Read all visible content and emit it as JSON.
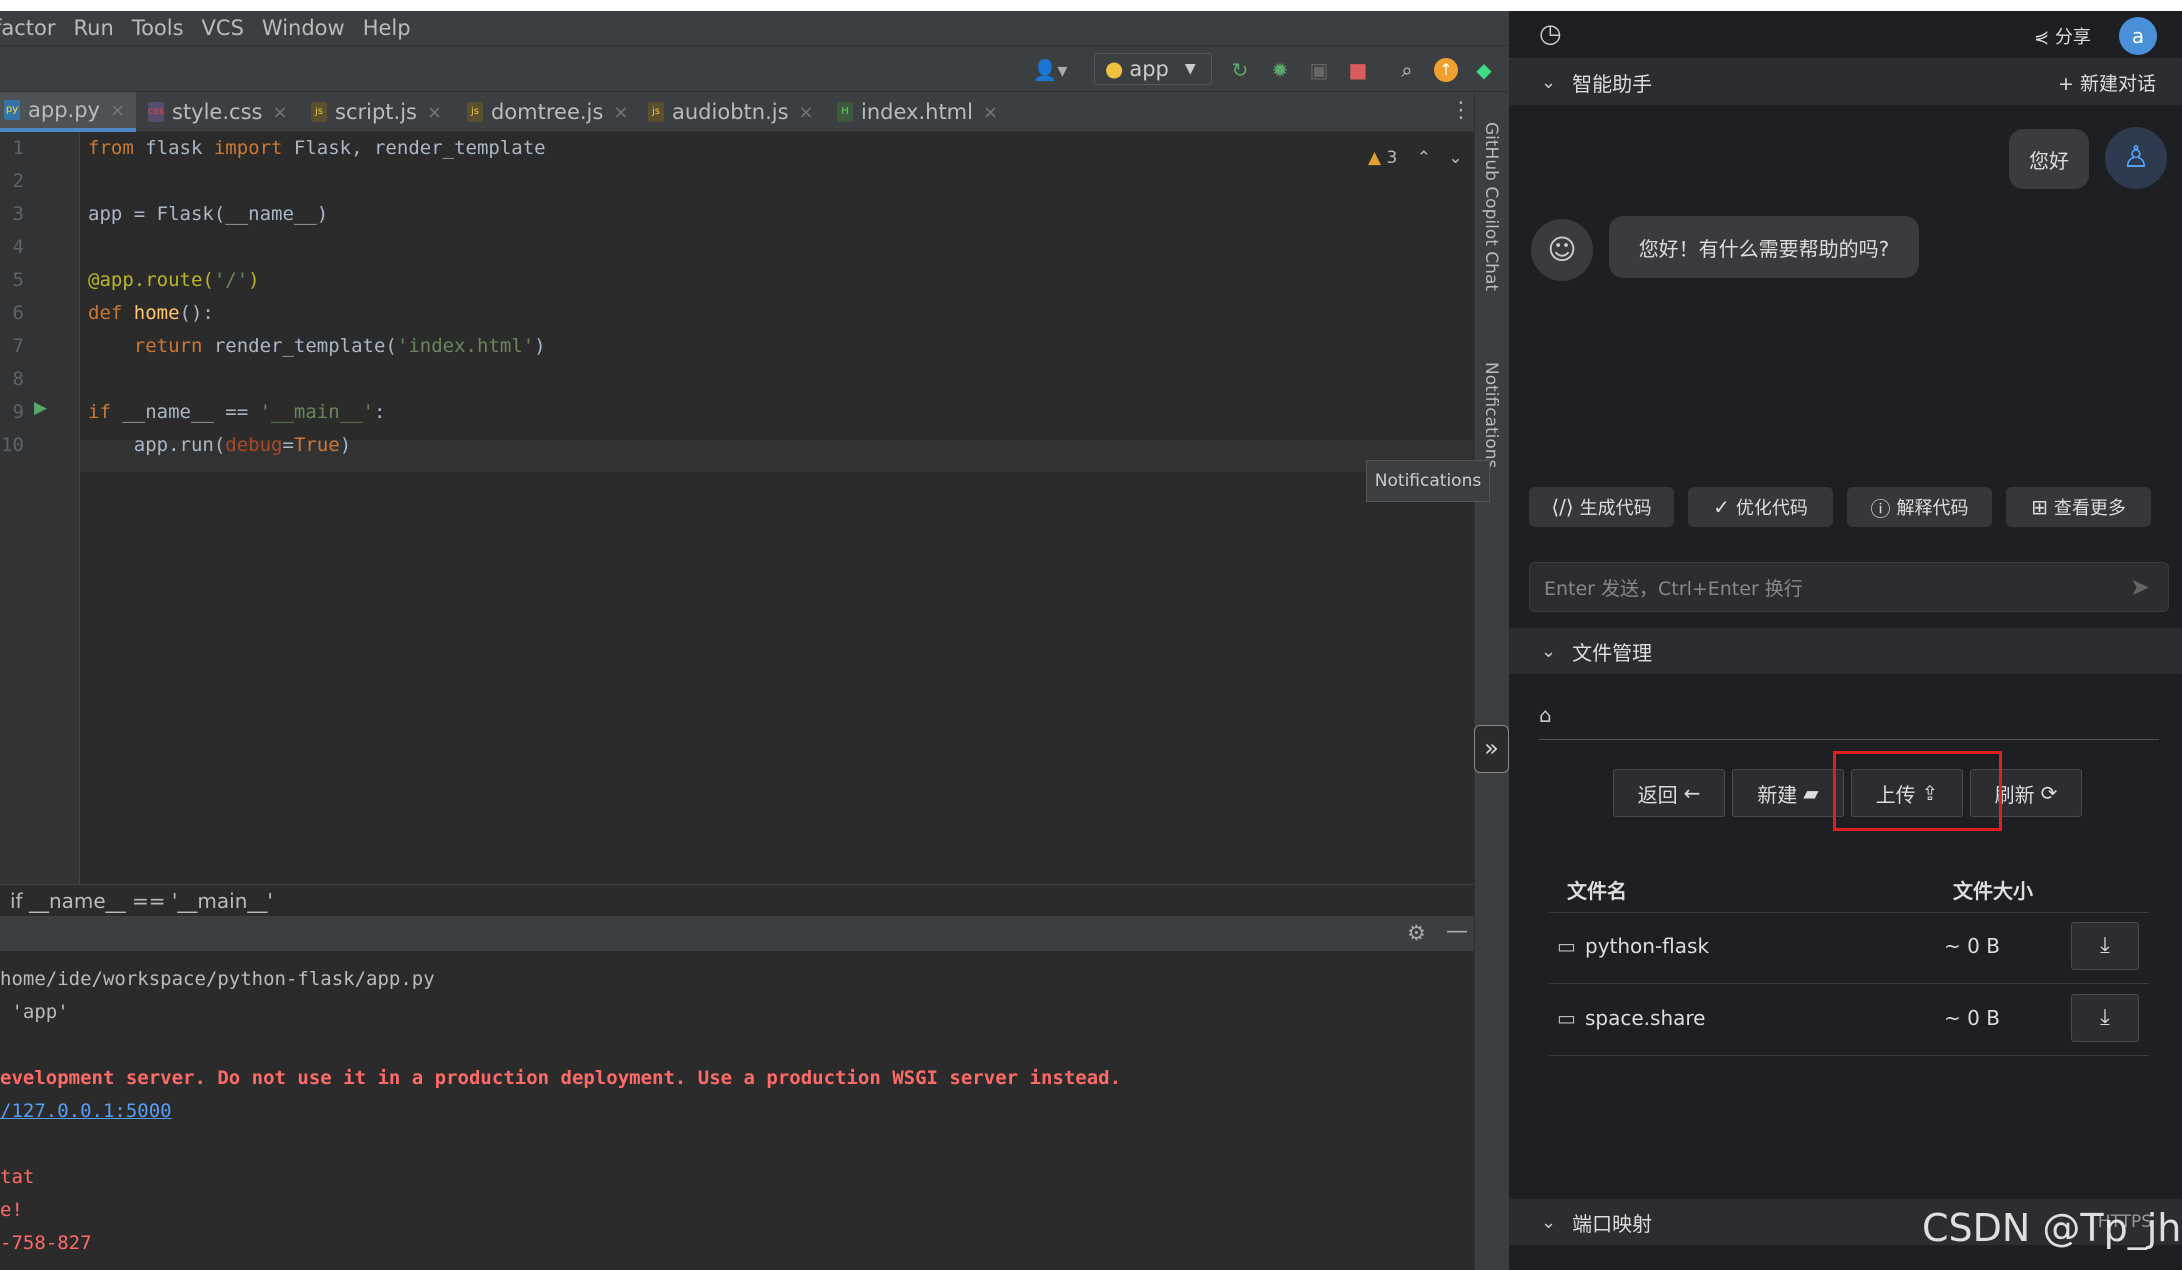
{
  "menu": [
    "factor",
    "Run",
    "Tools",
    "VCS",
    "Window",
    "Help"
  ],
  "toolbar": {
    "run_config": "app"
  },
  "tabs": [
    {
      "label": "app.py",
      "icon": "python-file-icon",
      "active": true
    },
    {
      "label": "style.css",
      "icon": "css-file-icon",
      "active": false
    },
    {
      "label": "script.js",
      "icon": "js-file-icon",
      "active": false
    },
    {
      "label": "domtree.js",
      "icon": "js-file-icon",
      "active": false
    },
    {
      "label": "audiobtn.js",
      "icon": "js-file-icon",
      "active": false
    },
    {
      "label": "index.html",
      "icon": "html-file-icon",
      "active": false
    }
  ],
  "editor": {
    "line_numbers": [
      "1",
      "2",
      "3",
      "4",
      "5",
      "6",
      "7",
      "8",
      "9",
      "10"
    ],
    "warning_count": "3",
    "lines": [
      "from flask import Flask, render_template",
      "",
      "app = Flask(__name__)",
      "",
      "@app.route('/')",
      "def home():",
      "    return render_template('index.html')",
      "",
      "if __name__ == '__main__':",
      "    app.run(debug=True)"
    ]
  },
  "side_strip": {
    "copilot": "GitHub Copilot Chat",
    "notifications": "Notifications"
  },
  "tooltip": "Notifications",
  "breadcrumb": "if __name__ == '__main__'",
  "console": [
    {
      "text": "home/ide/workspace/python-flask/app.py",
      "color": "#bbbbbb"
    },
    {
      "text": " 'app'",
      "color": "#bbbbbb"
    },
    {
      "text": "",
      "color": "#bbbbbb"
    },
    {
      "text": "evelopment server. Do not use it in a production deployment. Use a production WSGI server instead.",
      "color": "#ff6b68"
    },
    {
      "text": "/127.0.0.1:5000",
      "color": "#589df6"
    },
    {
      "text": "",
      "color": "#bbbbbb"
    },
    {
      "text": "tat",
      "color": "#ff6b68"
    },
    {
      "text": "e!",
      "color": "#ff6b68"
    },
    {
      "text": "-758-827",
      "color": "#ff6b68"
    }
  ],
  "panel": {
    "share": "分享",
    "user_initial": "a",
    "assistant": {
      "title": "智能助手",
      "new_chat": "新建对话"
    },
    "chat": {
      "user_msg": "您好",
      "bot_msg": "您好！有什么需要帮助的吗?"
    },
    "quick_actions": [
      "生成代码",
      "优化代码",
      "解释代码",
      "查看更多"
    ],
    "input_placeholder": "Enter 发送，Ctrl+Enter 换行",
    "file_manager": {
      "title": "文件管理",
      "buttons": [
        "返回",
        "新建",
        "上传",
        "刷新"
      ],
      "columns": [
        "文件名",
        "文件大小"
      ],
      "rows": [
        {
          "name": "python-flask",
          "size": "~ 0 B"
        },
        {
          "name": "space.share",
          "size": "~ 0 B"
        }
      ]
    },
    "port_mapping": {
      "title": "端口映射",
      "protocol": "HTTPS"
    }
  },
  "watermark": "CSDN @Tp_jh"
}
